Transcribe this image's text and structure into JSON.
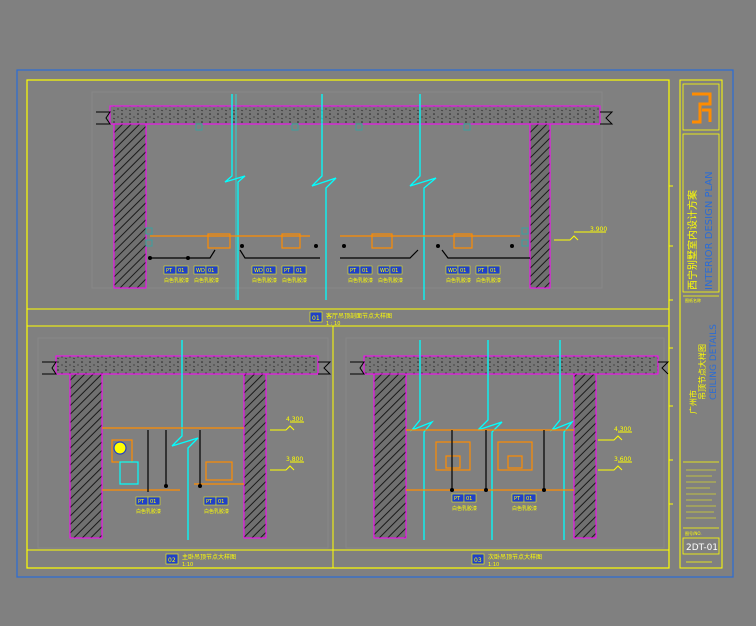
{
  "title_block": {
    "project_cn": "西宁别墅室内设计方案",
    "plan_en": "INTERIOR DESIGN PLAN",
    "heading_label": "图纸名称",
    "location_cn": "广州市",
    "drawing_cn": "吊顶节点大样图",
    "drawing_en": "CEILING  DETAILS",
    "drawing_no_label": "图号/NO.",
    "drawing_no": "2DT-01"
  },
  "details": [
    {
      "num": "01",
      "title": "客厅吊顶剖面节点大样图",
      "scale": "1 : 10"
    },
    {
      "num": "02",
      "title": "主卧吊顶节点大样图",
      "scale": "1:10"
    },
    {
      "num": "03",
      "title": "次卧吊顶节点大样图",
      "scale": "1:10"
    }
  ],
  "tags": {
    "pt": "PT",
    "pt_no": "01",
    "wd": "WD",
    "wd_no": "01",
    "note": "白色乳胶漆"
  },
  "levels": {
    "top": "3.900",
    "ceiling_02": "4.300",
    "ceiling_02b": "3.800",
    "ceiling_03": "4.300",
    "ceiling_03b": "3.600"
  },
  "colors": {
    "background": "#808080",
    "border_blue": "#2a6cd6",
    "frame_yellow": "#ffff00",
    "slab_magenta": "#ff00ff",
    "break_cyan": "#00ffff",
    "wood_orange": "#ff8c00",
    "tag_blue": "#2040c8"
  }
}
